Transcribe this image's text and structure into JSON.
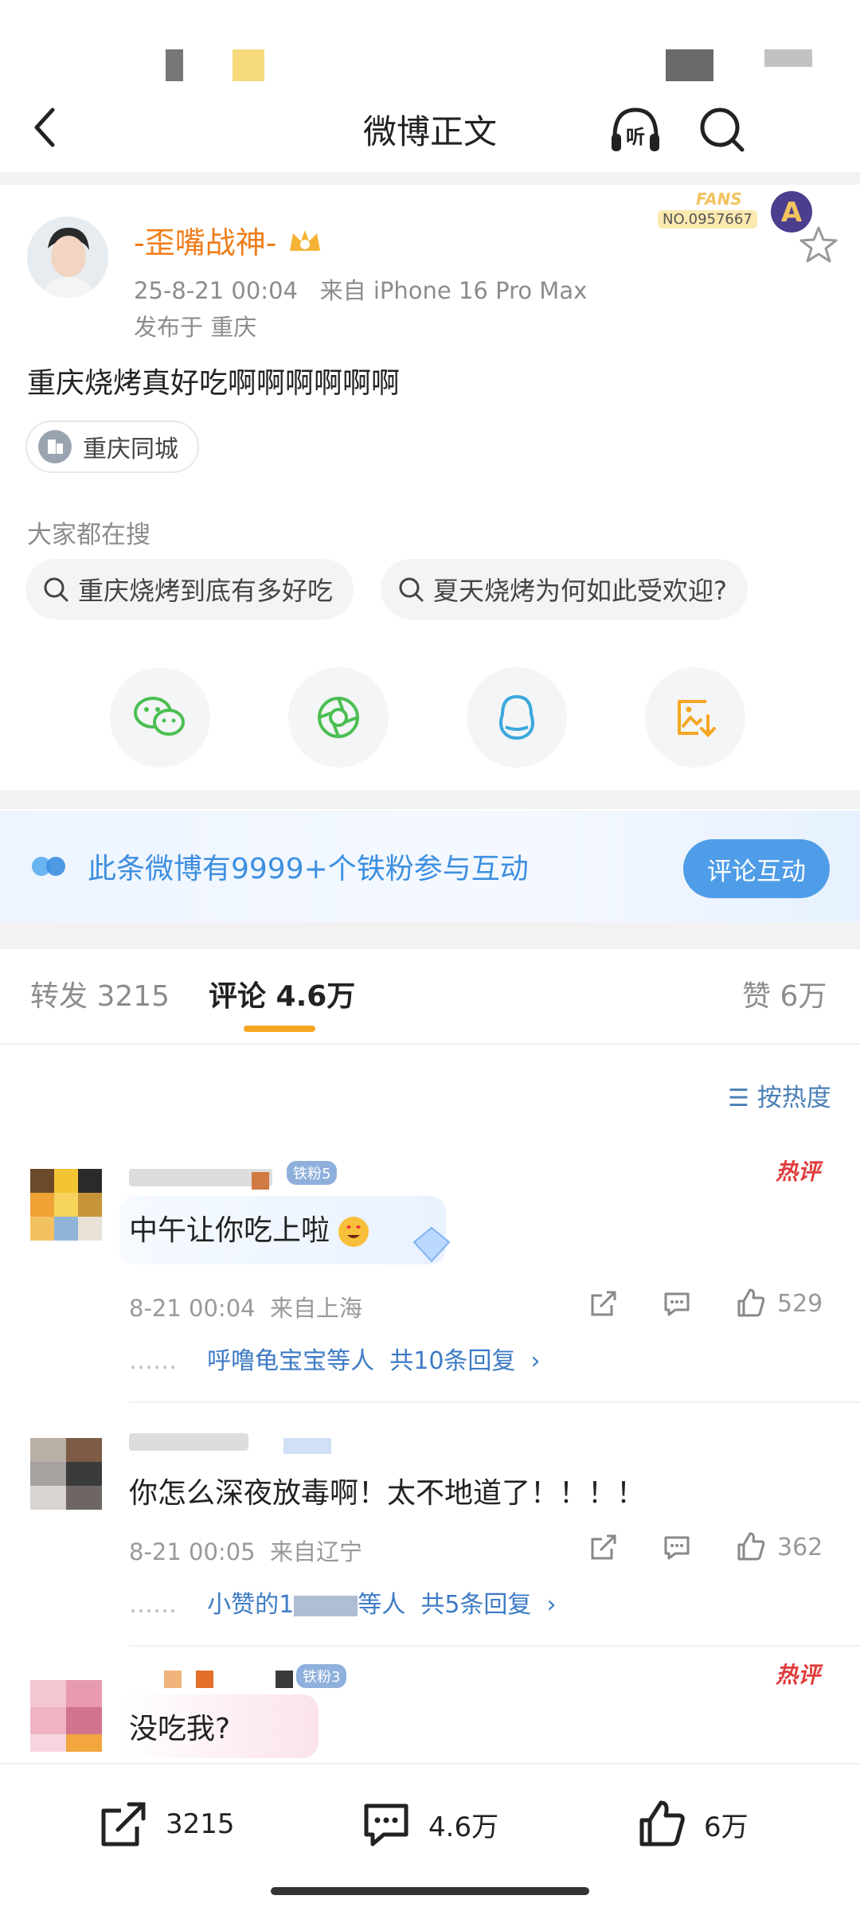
{
  "nav": {
    "title": "微博正文"
  },
  "post": {
    "username": "-歪嘴战神-",
    "fans_badge": "FANS",
    "fans_no": "NO.0957667",
    "time": "25-8-21 00:04",
    "source": "来自 iPhone 16 Pro Max",
    "location": "发布于 重庆",
    "content": "重庆烧烤真好吃啊啊啊啊啊啊",
    "topic_chip": "重庆同城",
    "search_label": "大家都在搜",
    "searches": [
      "重庆烧烤到底有多好吃",
      "夏天烧烤为何如此受欢迎?"
    ]
  },
  "share_icons": [
    "wechat-icon",
    "moments-icon",
    "qq-icon",
    "save-image-icon"
  ],
  "banner": {
    "text": "此条微博有9999+个铁粉参与互动",
    "button": "评论互动"
  },
  "tabs": {
    "repost": "转发 3215",
    "comment": "评论 4.6万",
    "like": "赞 6万"
  },
  "sort_label": "按热度",
  "comments": [
    {
      "badge": "铁粉5",
      "hot": "热评",
      "text": "中午让你吃上啦",
      "time": "8-21 00:04",
      "region": "来自上海",
      "likes": "529",
      "replies_prefix": "呼噜龟宝宝等人",
      "replies_count": "共10条回复"
    },
    {
      "text": "你怎么深夜放毒啊！太不地道了！！！！",
      "time": "8-21 00:05",
      "region": "来自辽宁",
      "likes": "362",
      "replies_prefix": "小赞的1",
      "replies_mid": "等人",
      "replies_count": "共5条回复"
    },
    {
      "badge": "铁粉3",
      "hot": "热评",
      "text": "没吃我?"
    }
  ],
  "bottom": {
    "reposts": "3215",
    "comments": "4.6万",
    "likes": "6万"
  }
}
